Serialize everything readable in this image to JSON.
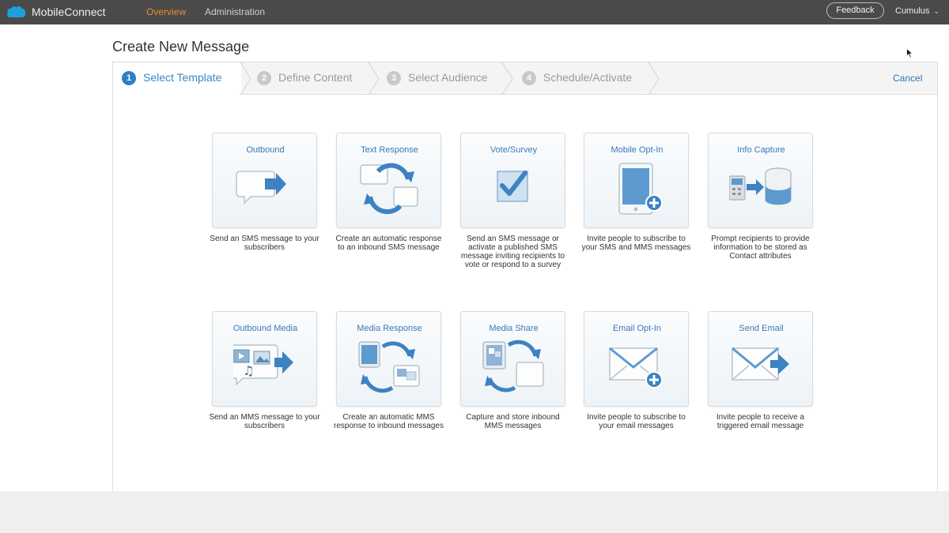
{
  "app": {
    "name": "MobileConnect",
    "nav": {
      "overview": "Overview",
      "administration": "Administration"
    },
    "feedback": "Feedback",
    "user": "Cumulus",
    "accent": "#e8902e"
  },
  "page": {
    "title": "Create New Message"
  },
  "wizard": {
    "steps": [
      {
        "num": "1",
        "label": "Select Template",
        "active": true
      },
      {
        "num": "2",
        "label": "Define Content",
        "active": false
      },
      {
        "num": "3",
        "label": "Select Audience",
        "active": false
      },
      {
        "num": "4",
        "label": "Schedule/Activate",
        "active": false
      }
    ],
    "cancel": "Cancel"
  },
  "templates": [
    {
      "title": "Outbound",
      "desc": "Send an SMS message to your subscribers",
      "icon": "outbound-icon"
    },
    {
      "title": "Text Response",
      "desc": "Create an automatic response to an inbound SMS message",
      "icon": "text-response-icon"
    },
    {
      "title": "Vote/Survey",
      "desc": "Send an SMS message or activate a published SMS message inviting recipients to vote or respond to a survey",
      "icon": "vote-survey-icon"
    },
    {
      "title": "Mobile Opt-In",
      "desc": "Invite people to subscribe to your SMS and MMS messages",
      "icon": "mobile-opt-in-icon"
    },
    {
      "title": "Info Capture",
      "desc": "Prompt recipients to provide information to be stored as Contact attributes",
      "icon": "info-capture-icon"
    },
    {
      "title": "Outbound Media",
      "desc": "Send an MMS message to your subscribers",
      "icon": "outbound-media-icon"
    },
    {
      "title": "Media Response",
      "desc": "Create an automatic MMS response to inbound messages",
      "icon": "media-response-icon"
    },
    {
      "title": "Media Share",
      "desc": "Capture and store inbound MMS messages",
      "icon": "media-share-icon"
    },
    {
      "title": "Email Opt-In",
      "desc": "Invite people to subscribe to your email messages",
      "icon": "email-opt-in-icon"
    },
    {
      "title": "Send Email",
      "desc": "Invite people to receive a triggered email message",
      "icon": "send-email-icon"
    }
  ]
}
